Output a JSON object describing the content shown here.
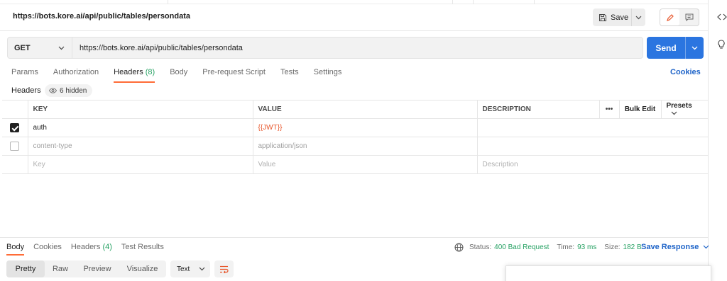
{
  "request": {
    "title": "https://bots.kore.ai/api/public/tables/persondata",
    "save_label": "Save",
    "method": "GET",
    "url": "https://bots.kore.ai/api/public/tables/persondata",
    "send_label": "Send"
  },
  "tabs": [
    {
      "label": "Params"
    },
    {
      "label": "Authorization"
    },
    {
      "label": "Headers",
      "count": "(8)"
    },
    {
      "label": "Body"
    },
    {
      "label": "Pre-request Script"
    },
    {
      "label": "Tests"
    },
    {
      "label": "Settings"
    }
  ],
  "cookies_label": "Cookies",
  "headers_section": {
    "title": "Headers",
    "hidden_label": "6 hidden",
    "columns": [
      "KEY",
      "VALUE",
      "DESCRIPTION"
    ],
    "bulk_edit": "Bulk Edit",
    "presets": "Presets",
    "rows": [
      {
        "key": "auth",
        "value": "{{JWT}}",
        "description": ""
      },
      {
        "key": "content-type",
        "value": "application/json",
        "description": ""
      }
    ],
    "placeholders": {
      "key": "Key",
      "value": "Value",
      "description": "Description"
    }
  },
  "response": {
    "tabs": [
      {
        "label": "Body"
      },
      {
        "label": "Cookies"
      },
      {
        "label": "Headers",
        "count": "(4)"
      },
      {
        "label": "Test Results"
      }
    ],
    "status_label": "Status:",
    "status_value": "400 Bad Request",
    "time_label": "Time:",
    "time_value": "93 ms",
    "size_label": "Size:",
    "size_value": "182 B",
    "save_response": "Save Response",
    "views": [
      "Pretty",
      "Raw",
      "Preview",
      "Visualize"
    ],
    "format": "Text"
  },
  "colors": {
    "accent": "#ff6c37",
    "send": "#2b75e0",
    "link": "#1f64c8",
    "success": "#26a163",
    "variable": "#e8562b"
  }
}
